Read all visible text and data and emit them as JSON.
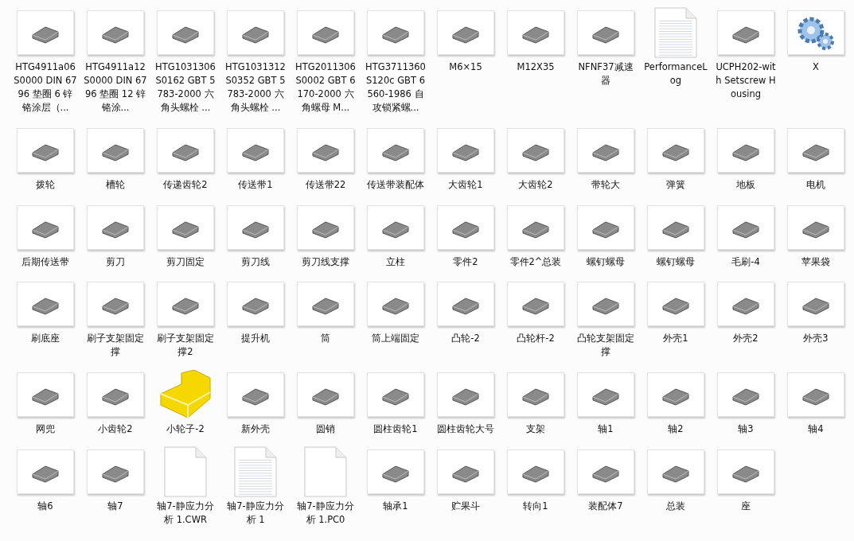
{
  "files": [
    {
      "name": "HTG4911a06S0000 DIN 6796 垫圈 6 锌铬涂层（...",
      "kind": "model"
    },
    {
      "name": "HTG4911a12S0000 DIN 6796 垫圈 12 锌铬涂...",
      "kind": "model"
    },
    {
      "name": "HTG1031306S0162 GBT 5783-2000 六角头螺栓 ...",
      "kind": "model"
    },
    {
      "name": "HTG1031312S0352 GBT 5783-2000 六角头螺栓 ...",
      "kind": "model"
    },
    {
      "name": "HTG2011306S0002 GBT 6170-2000 六角螺母 M...",
      "kind": "model"
    },
    {
      "name": "HTG3711360S120c GBT 6560-1986 自攻锁紧螺...",
      "kind": "model"
    },
    {
      "name": "M6×15",
      "kind": "model"
    },
    {
      "name": "M12X35",
      "kind": "model"
    },
    {
      "name": "NFNF37减速器",
      "kind": "model"
    },
    {
      "name": "PerformanceLog",
      "kind": "document"
    },
    {
      "name": "UCPH202-with Setscrew Housing",
      "kind": "model"
    },
    {
      "name": "X",
      "kind": "settings"
    },
    {
      "name": "拨轮",
      "kind": "model"
    },
    {
      "name": "槽轮",
      "kind": "model"
    },
    {
      "name": "传递齿轮2",
      "kind": "model"
    },
    {
      "name": "传送带1",
      "kind": "model"
    },
    {
      "name": "传送带22",
      "kind": "model"
    },
    {
      "name": "传送带装配体",
      "kind": "model"
    },
    {
      "name": "大齿轮1",
      "kind": "model"
    },
    {
      "name": "大齿轮2",
      "kind": "model"
    },
    {
      "name": "带轮大",
      "kind": "model"
    },
    {
      "name": "弹簧",
      "kind": "model"
    },
    {
      "name": "地板",
      "kind": "model"
    },
    {
      "name": "电机",
      "kind": "model"
    },
    {
      "name": "后期传送带",
      "kind": "model"
    },
    {
      "name": "剪刀",
      "kind": "model"
    },
    {
      "name": "剪刀固定",
      "kind": "model"
    },
    {
      "name": "剪刀线",
      "kind": "model"
    },
    {
      "name": "剪刀线支撑",
      "kind": "model"
    },
    {
      "name": "立柱",
      "kind": "model"
    },
    {
      "name": "零件2",
      "kind": "model"
    },
    {
      "name": "零件2^总装",
      "kind": "model"
    },
    {
      "name": "螺钉螺母",
      "kind": "model"
    },
    {
      "name": "螺钉螺母",
      "kind": "model"
    },
    {
      "name": "毛刷-4",
      "kind": "model"
    },
    {
      "name": "苹果袋",
      "kind": "model"
    },
    {
      "name": "刷底座",
      "kind": "model"
    },
    {
      "name": "刷子支架固定撑",
      "kind": "model"
    },
    {
      "name": "刷子支架固定撑2",
      "kind": "model"
    },
    {
      "name": "提升机",
      "kind": "model"
    },
    {
      "name": "筒",
      "kind": "model"
    },
    {
      "name": "筒上端固定",
      "kind": "model"
    },
    {
      "name": "凸轮-2",
      "kind": "model"
    },
    {
      "name": "凸轮杆-2",
      "kind": "model"
    },
    {
      "name": "凸轮支架固定撑",
      "kind": "model"
    },
    {
      "name": "外壳1",
      "kind": "model"
    },
    {
      "name": "外壳2",
      "kind": "model"
    },
    {
      "name": "外壳3",
      "kind": "model"
    },
    {
      "name": "网兜",
      "kind": "model"
    },
    {
      "name": "小齿轮2",
      "kind": "model"
    },
    {
      "name": "小轮子-2",
      "kind": "block"
    },
    {
      "name": "新外壳",
      "kind": "model"
    },
    {
      "name": "圆销",
      "kind": "model"
    },
    {
      "name": "圆柱齿轮1",
      "kind": "model"
    },
    {
      "name": "圆柱齿轮大号",
      "kind": "model"
    },
    {
      "name": "支架",
      "kind": "model"
    },
    {
      "name": "轴1",
      "kind": "model"
    },
    {
      "name": "轴2",
      "kind": "model"
    },
    {
      "name": "轴3",
      "kind": "model"
    },
    {
      "name": "轴4",
      "kind": "model"
    },
    {
      "name": "轴6",
      "kind": "model"
    },
    {
      "name": "轴7",
      "kind": "model"
    },
    {
      "name": "轴7-静应力分析 1.CWR",
      "kind": "blank"
    },
    {
      "name": "轴7-静应力分析 1",
      "kind": "document"
    },
    {
      "name": "轴7-静应力分析 1.PC0",
      "kind": "blank"
    },
    {
      "name": "轴承1",
      "kind": "model"
    },
    {
      "name": "贮果斗",
      "kind": "model"
    },
    {
      "name": "转向1",
      "kind": "model"
    },
    {
      "name": "装配体7",
      "kind": "model"
    },
    {
      "name": "总装",
      "kind": "model"
    },
    {
      "name": "座",
      "kind": "model"
    }
  ]
}
